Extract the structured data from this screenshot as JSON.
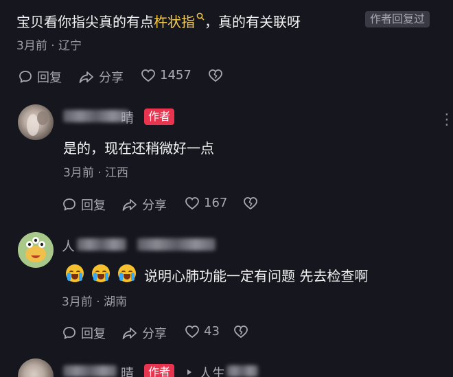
{
  "top_comment": {
    "text_before": "宝贝看你指尖真的有点",
    "text_highlight": "杵状指",
    "text_after": "，真的有关联呀",
    "badge": "作者回复过",
    "meta": "3月前 · 辽宁",
    "reply_label": "回复",
    "share_label": "分享",
    "like_count": "1457"
  },
  "reply1": {
    "name_visible": "晴",
    "author_tag": "作者",
    "text": "是的，现在还稍微好一点",
    "meta": "3月前 · 江西",
    "reply_label": "回复",
    "share_label": "分享",
    "like_count": "167"
  },
  "reply2": {
    "name_visible": "人",
    "text": "说明心肺功能一定有问题 先去检查啊",
    "meta": "3月前 · 湖南",
    "reply_label": "回复",
    "share_label": "分享",
    "like_count": "43"
  },
  "reply3": {
    "name_visible": "晴",
    "author_tag": "作者",
    "reply_to_visible": "人生"
  },
  "colors": {
    "highlight": "#f2c94c",
    "author_tag": "#e8344e",
    "background": "#16161e"
  },
  "icons": [
    "comment-icon",
    "share-icon",
    "heart-icon",
    "broken-heart-icon",
    "search-icon",
    "more-icon",
    "reply-arrow-icon"
  ]
}
